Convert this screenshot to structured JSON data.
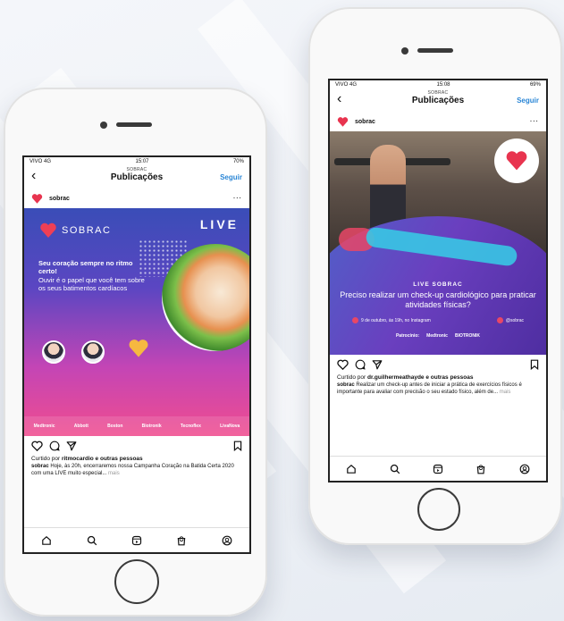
{
  "left_phone": {
    "status": {
      "carrier": "VIVO 4G",
      "time": "15:07",
      "battery": "70%"
    },
    "header": {
      "subtitle": "SOBRAC",
      "title": "Publicações",
      "follow": "Seguir"
    },
    "account": "sobrac",
    "post": {
      "logo_text": "SOBRAC",
      "live_label": "LIVE",
      "headline_bold": "Seu coração sempre no ritmo certo!",
      "headline_body": "Ouvir é o papel que você tem sobre os seus batimentos cardíacos",
      "sponsors": [
        "Medtronic",
        "Abbott",
        "Boston",
        "Biotronik",
        "Tecnoflex",
        "LivaNova"
      ]
    },
    "liked_by_prefix": "Curtido por",
    "liked_by_user": "ritmocardio",
    "liked_by_suffix": "e outras pessoas",
    "caption_user": "sobrac",
    "caption_text": "Hoje, às 20h, encerraremos nossa Campanha Coração na Batida Certa 2020 com uma LIVE muito especial...",
    "caption_more": "mais"
  },
  "right_phone": {
    "status": {
      "carrier": "VIVO 4G",
      "time": "15:08",
      "battery": "69%"
    },
    "header": {
      "subtitle": "SOBRAC",
      "title": "Publicações",
      "follow": "Seguir"
    },
    "account": "sobrac",
    "post": {
      "live_label": "LIVE SOBRAC",
      "question": "Preciso realizar um check-up cardiológico para praticar atividades físicas?",
      "meta_left": "9 de outubro, às 19h, no Instagram",
      "meta_right": "@sobrac",
      "sponsors": [
        "Patrocínio:",
        "Medtronic",
        "BIOTRONIK"
      ]
    },
    "liked_by_prefix": "Curtido por",
    "liked_by_user": "dr.guilhermeathayde",
    "liked_by_suffix": "e outras pessoas",
    "caption_user": "sobrac",
    "caption_text": "Realizar um check-up antes de iniciar a prática de exercícios físicos é importante para avaliar com precisão o seu estado físico, além de...",
    "caption_more": "mais"
  },
  "colors": {
    "accent": "#2a86d6",
    "brand_red": "#e8344f"
  },
  "icons": [
    "back-icon",
    "heart-logo-icon",
    "more-icon",
    "like-icon",
    "comment-icon",
    "share-icon",
    "save-icon",
    "home-icon",
    "search-icon",
    "reels-icon",
    "shop-icon",
    "profile-icon"
  ]
}
